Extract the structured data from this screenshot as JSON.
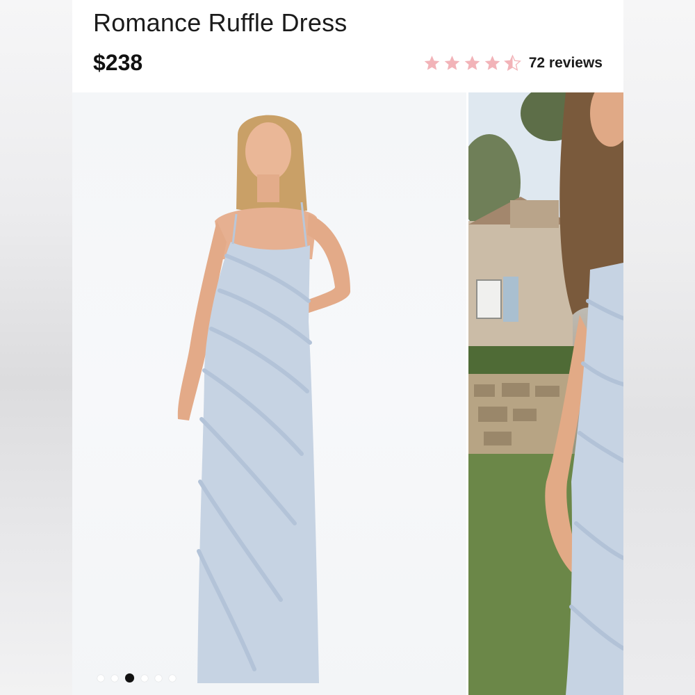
{
  "product": {
    "title": "Romance Ruffle Dress",
    "price": "$238",
    "rating": 4.5,
    "reviews_label": "72 reviews"
  },
  "stars": [
    {
      "icon": "star-full-icon"
    },
    {
      "icon": "star-full-icon"
    },
    {
      "icon": "star-full-icon"
    },
    {
      "icon": "star-full-icon"
    },
    {
      "icon": "star-half-icon"
    }
  ],
  "colors": {
    "star": "#f2b3b8",
    "star_empty": "#ffffff",
    "dress": "#c6d3e3",
    "text": "#1b1b1b"
  },
  "gallery": {
    "images": [
      {
        "name": "product-photo-studio",
        "subject": "model-in-blue-ruffle-dress"
      },
      {
        "name": "product-photo-outdoor",
        "subject": "model-in-blue-ruffle-dress-garden"
      }
    ],
    "dot_count": 6,
    "active_dot": 2
  }
}
